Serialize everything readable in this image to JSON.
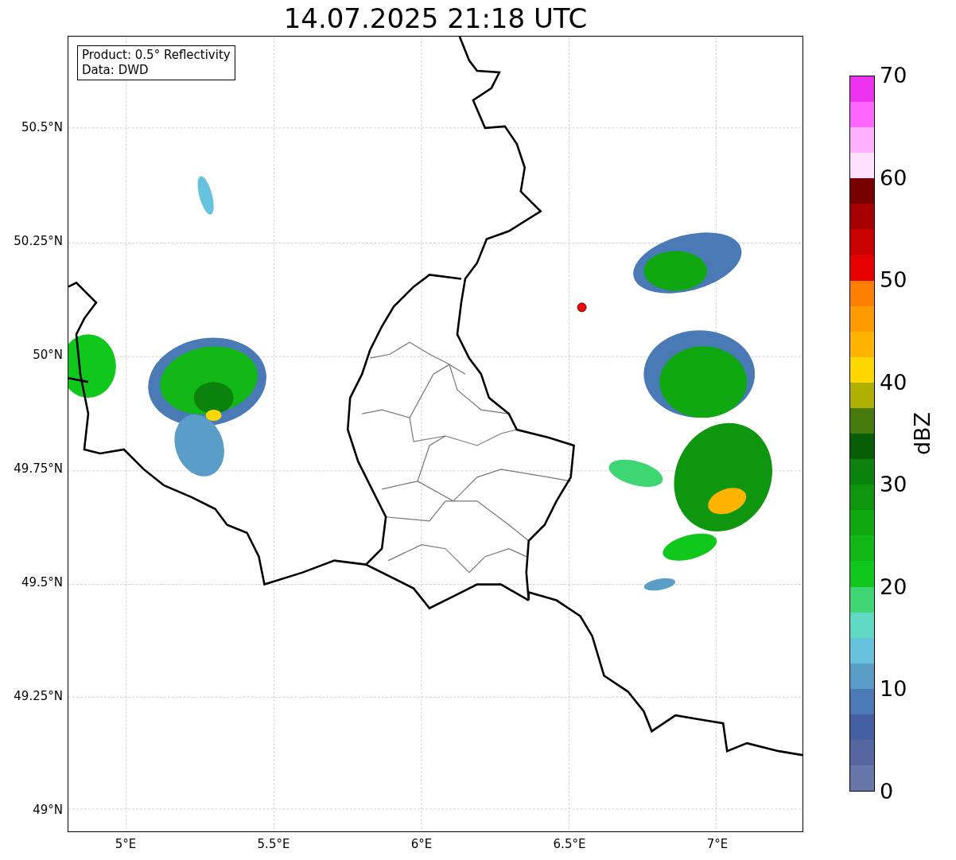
{
  "title": "14.07.2025 21:18 UTC",
  "legend": [
    "Product: 0.5° Reflectivity",
    "Data: DWD"
  ],
  "lat_ticks": [
    "50.5°N",
    "50.25°N",
    "50°N",
    "49.75°N",
    "49.5°N",
    "49.25°N",
    "49°N"
  ],
  "lon_ticks": [
    "5°E",
    "5.5°E",
    "6°E",
    "6.5°E",
    "7°E"
  ],
  "colorbar": {
    "label": "dBZ",
    "ticks": [
      "70",
      "60",
      "50",
      "40",
      "30",
      "20",
      "10",
      "0"
    ],
    "bins": [
      {
        "color": "#ee33ee"
      },
      {
        "color": "#ff66ff"
      },
      {
        "color": "#ffb0ff"
      },
      {
        "color": "#ffe0ff"
      },
      {
        "color": "#780000"
      },
      {
        "color": "#a60000"
      },
      {
        "color": "#c80000"
      },
      {
        "color": "#e60000"
      },
      {
        "color": "#ff8000"
      },
      {
        "color": "#ff9a00"
      },
      {
        "color": "#ffb400"
      },
      {
        "color": "#ffd700"
      },
      {
        "color": "#b0b000"
      },
      {
        "color": "#477a0c"
      },
      {
        "color": "#075e07"
      },
      {
        "color": "#0b820b"
      },
      {
        "color": "#0f960f"
      },
      {
        "color": "#10a810"
      },
      {
        "color": "#12b815"
      },
      {
        "color": "#10c81c"
      },
      {
        "color": "#3ed672"
      },
      {
        "color": "#5fd8c4"
      },
      {
        "color": "#66c2dd"
      },
      {
        "color": "#5a9ec8"
      },
      {
        "color": "#4a7ab5"
      },
      {
        "color": "#4460a2"
      },
      {
        "color": "#5566a0"
      },
      {
        "color": "#6677aa"
      }
    ]
  }
}
